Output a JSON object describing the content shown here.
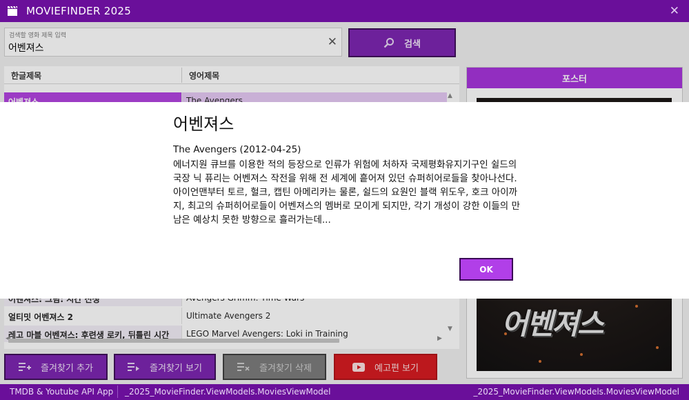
{
  "window": {
    "title": "MOVIEFINDER 2025"
  },
  "search": {
    "hint": "검색할 영화 제목 입력",
    "value": "어벤져스",
    "button_label": "검색"
  },
  "grid": {
    "columns": [
      "한글제목",
      "영어제목"
    ],
    "rows": [
      {
        "ko": "어벤져스",
        "en": "The Avengers"
      },
      {
        "ko": "어벤져스: 그림: 시간 전쟁",
        "en": "Avengers Grimm: Time Wars"
      },
      {
        "ko": "얼티밋 어벤져스 2",
        "en": "Ultimate Avengers 2"
      },
      {
        "ko": "레고 마블 어벤져스: 후련생 로키, 뒤틀린 시간",
        "en": "LEGO Marvel Avengers: Loki in Training"
      }
    ]
  },
  "poster": {
    "header": "포스터",
    "title_art": "어벤져스"
  },
  "buttons": {
    "add_favorite": "즐겨찾기 추가",
    "view_favorite": "즐겨찾기 보기",
    "delete_favorite": "즐겨찾기 삭제",
    "trailer": "예고편 보기"
  },
  "status": {
    "left": "TMDB & Youtube API App",
    "middle": "_2025_MovieFinder.ViewModels.MoviesViewModel",
    "right": "_2025_MovieFinder.ViewModels.MoviesViewModel"
  },
  "dialog": {
    "title": "어벤져스",
    "subtitle": "The Avengers (2012-04-25)",
    "body": "에너지원 큐브를 이용한 적의 등장으로 인류가 위험에 처하자 국제평화유지기구인 쉴드의 국장 닉 퓨리는 어벤져스 작전을 위해 전 세계에 흩어져 있던 슈퍼히어로들을 찾아나선다. 아이언맨부터 토르, 헐크, 캡틴 아메리카는 물론, 쉴드의 요원인 블랙 위도우, 호크 아이까지, 최고의 슈퍼히어로들이 어벤져스의 멤버로 모이게 되지만, 각기 개성이 강한 이들의 만남은 예상치 못한 방향으로 흘러가는데...",
    "ok_label": "OK"
  },
  "colors": {
    "titlebar": "#6a0f9a",
    "accent": "#b13fe0",
    "button": "#7a20b0",
    "trailer": "#d6161c"
  },
  "icons": [
    "film-icon",
    "close-icon",
    "search-icon",
    "add-list-icon",
    "play-list-icon",
    "delete-list-icon",
    "youtube-icon"
  ]
}
